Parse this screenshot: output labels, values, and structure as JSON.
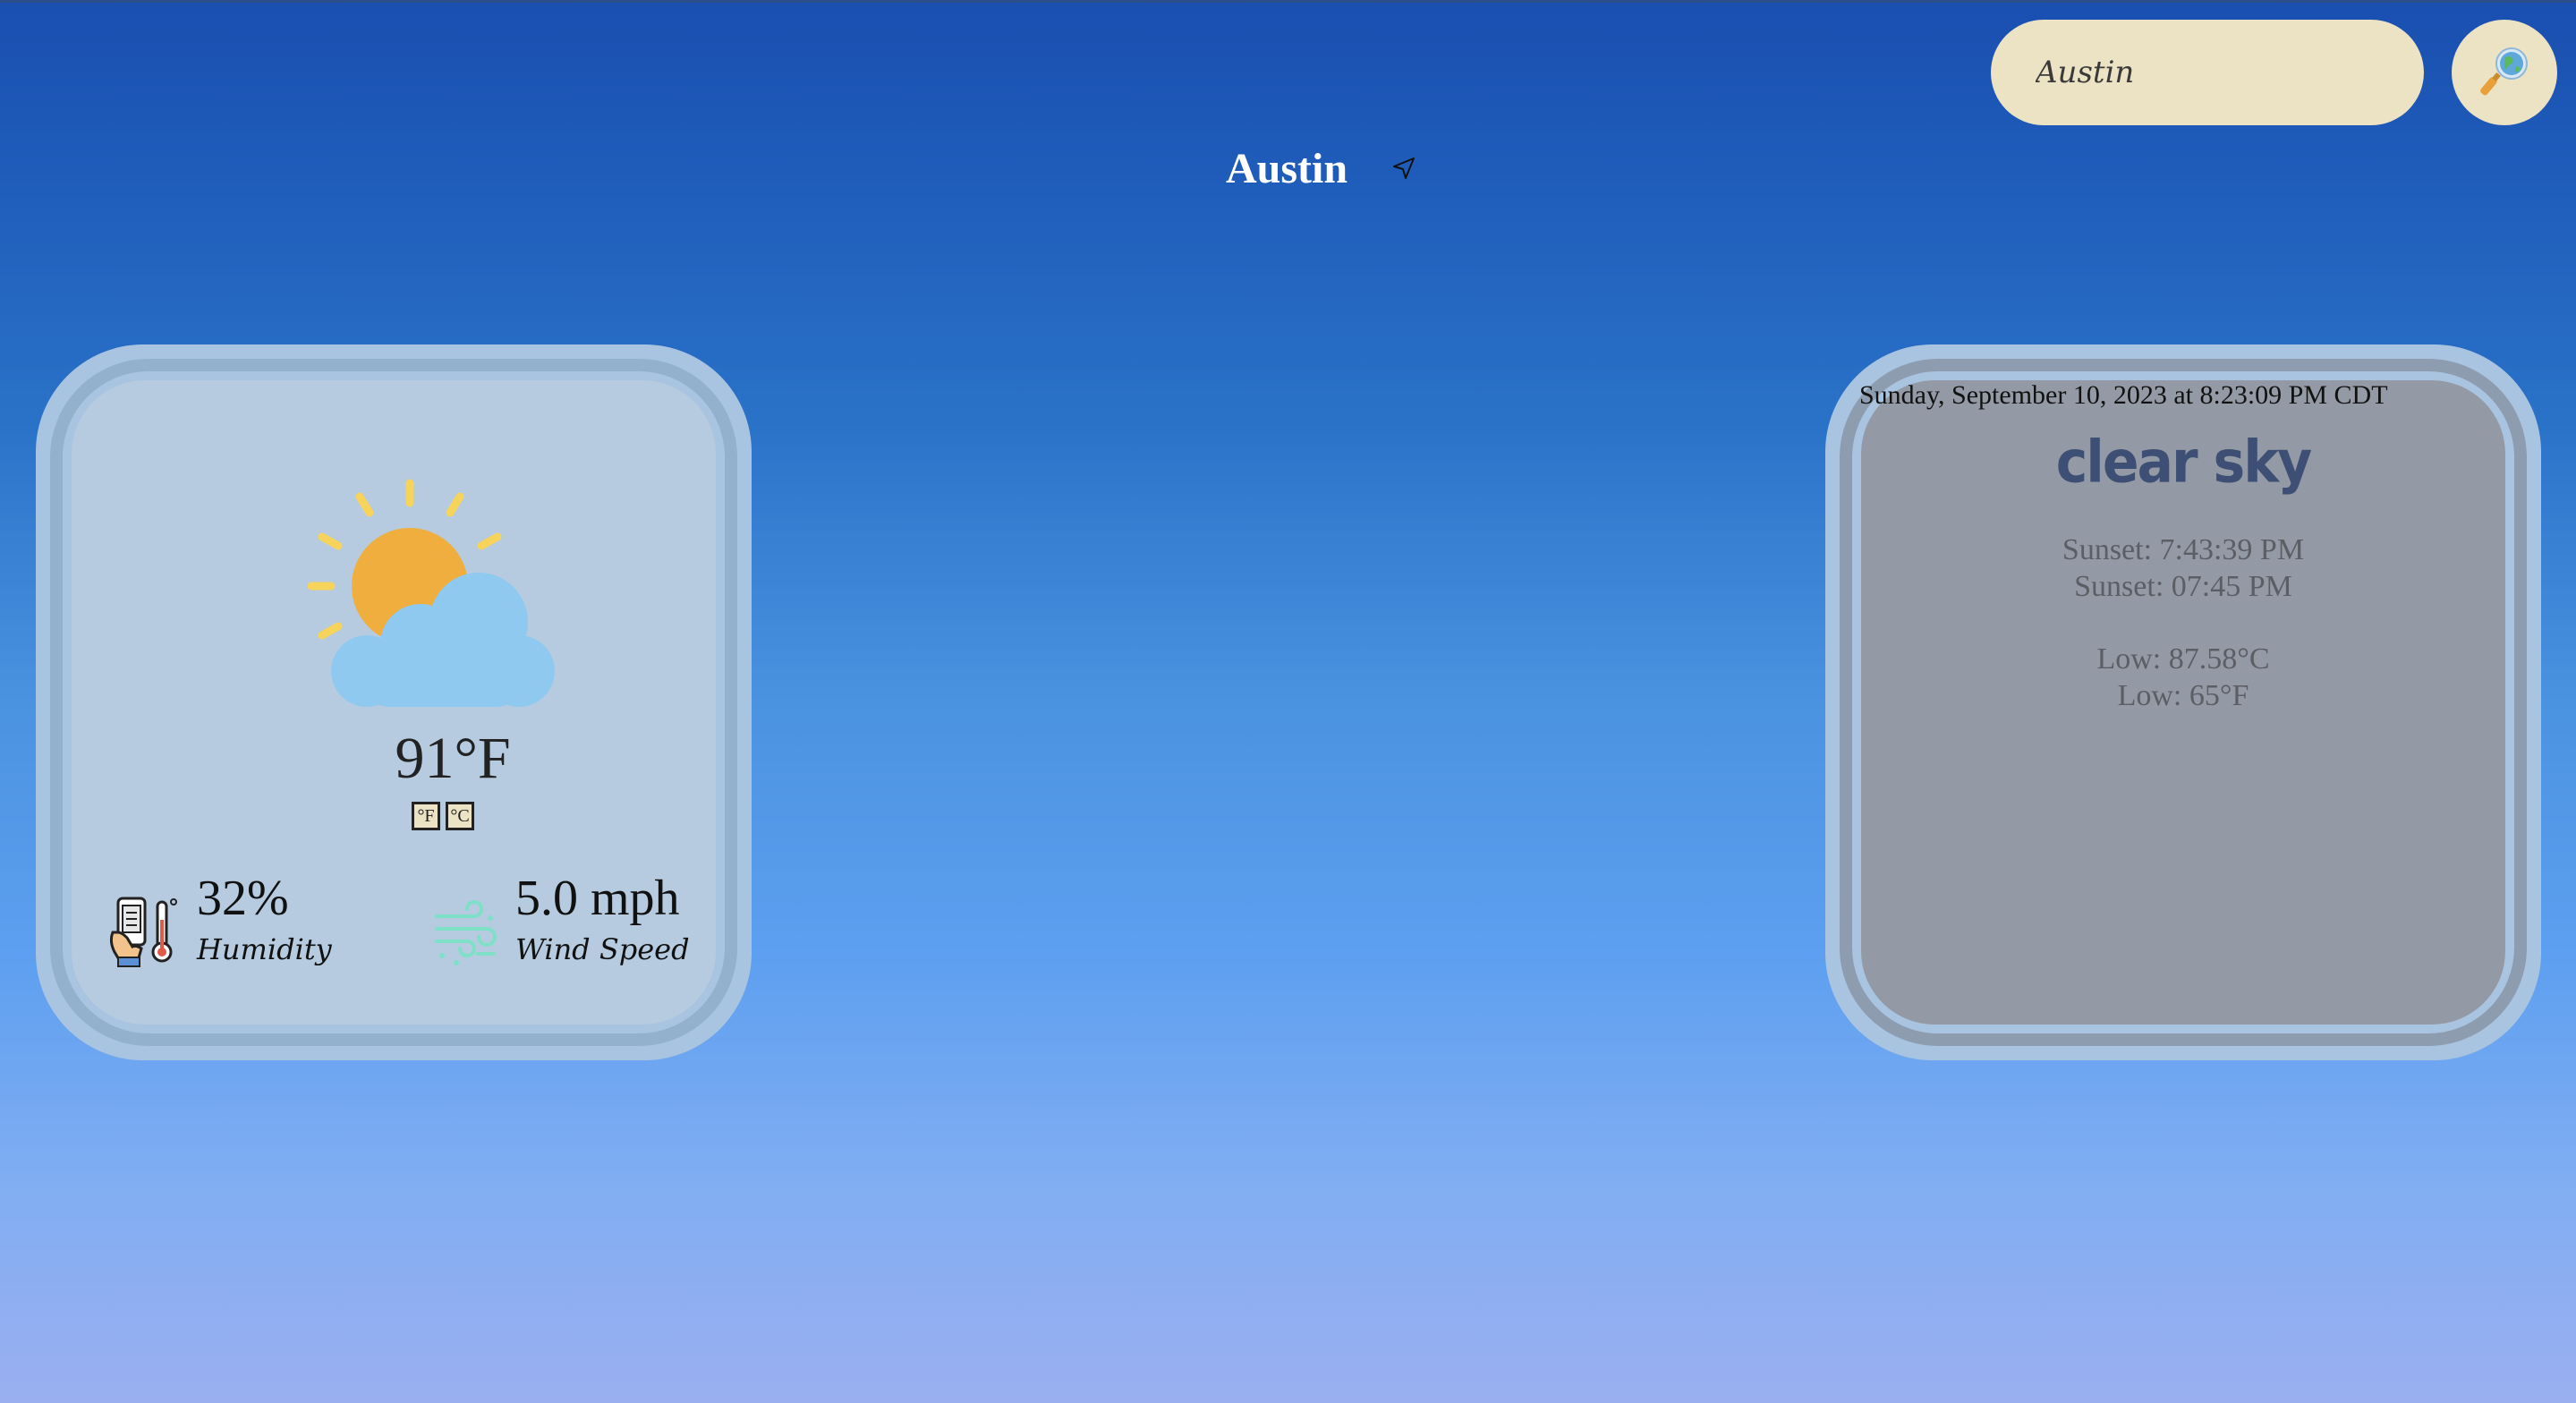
{
  "search": {
    "value": "Austin",
    "button_icon": "globe-magnifier-icon"
  },
  "location": {
    "city": "Austin",
    "locate_icon": "location-arrow-icon"
  },
  "current": {
    "condition_icon": "partly-cloudy-sun-icon",
    "temperature": "91°F",
    "unit_fahrenheit": "°F",
    "unit_celsius": "°C",
    "humidity_value": "32%",
    "humidity_label": "Humidity",
    "humidity_icon": "hand-phone-thermometer-icon",
    "wind_value": "5.0 mph",
    "wind_label": "Wind Speed",
    "wind_icon": "wind-icon"
  },
  "details": {
    "datetime": "Sunday, September 10, 2023 at 8:23:09 PM CDT",
    "condition": "clear sky",
    "sunset_1": "Sunset: 7:43:39 PM",
    "sunset_2": "Sunset: 07:45 PM",
    "low_1": "Low: 87.58°C",
    "low_2": "Low: 65°F"
  },
  "colors": {
    "card_left": "#b6cbe0",
    "card_right": "#949aa5",
    "input_bg": "#ece2c4",
    "condition_text": "#3e4f75"
  }
}
